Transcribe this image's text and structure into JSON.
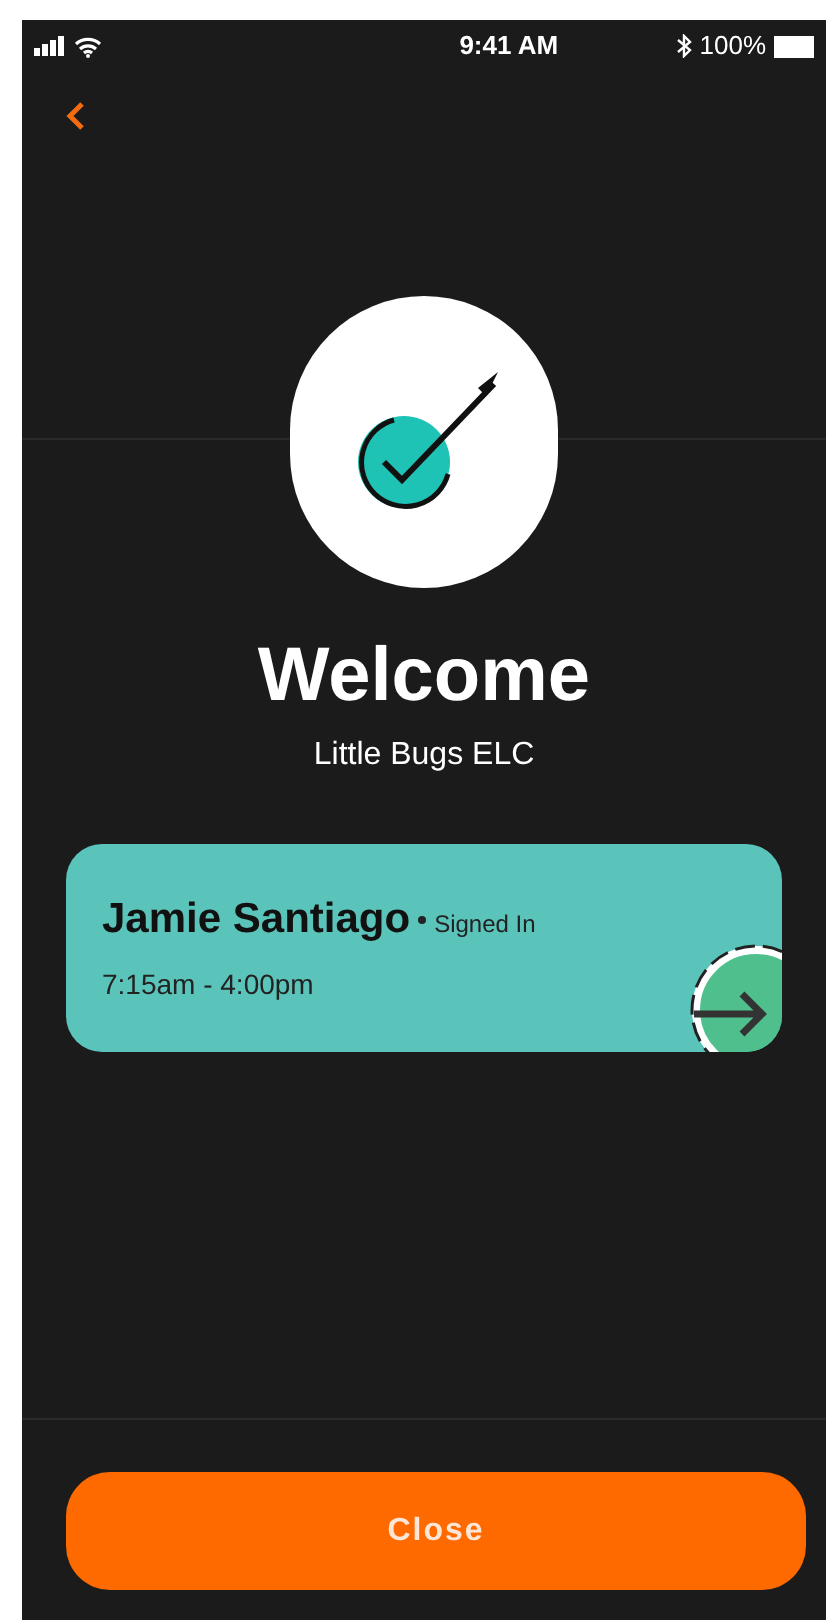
{
  "status_bar": {
    "time": "9:41 AM",
    "battery": "100%"
  },
  "welcome": {
    "title": "Welcome",
    "subtitle": "Little Bugs ELC"
  },
  "attendance": [
    {
      "name": "Jamie Santiago",
      "status": "Signed In",
      "hours": "7:15am - 4:00pm"
    }
  ],
  "buttons": [
    "Close"
  ]
}
